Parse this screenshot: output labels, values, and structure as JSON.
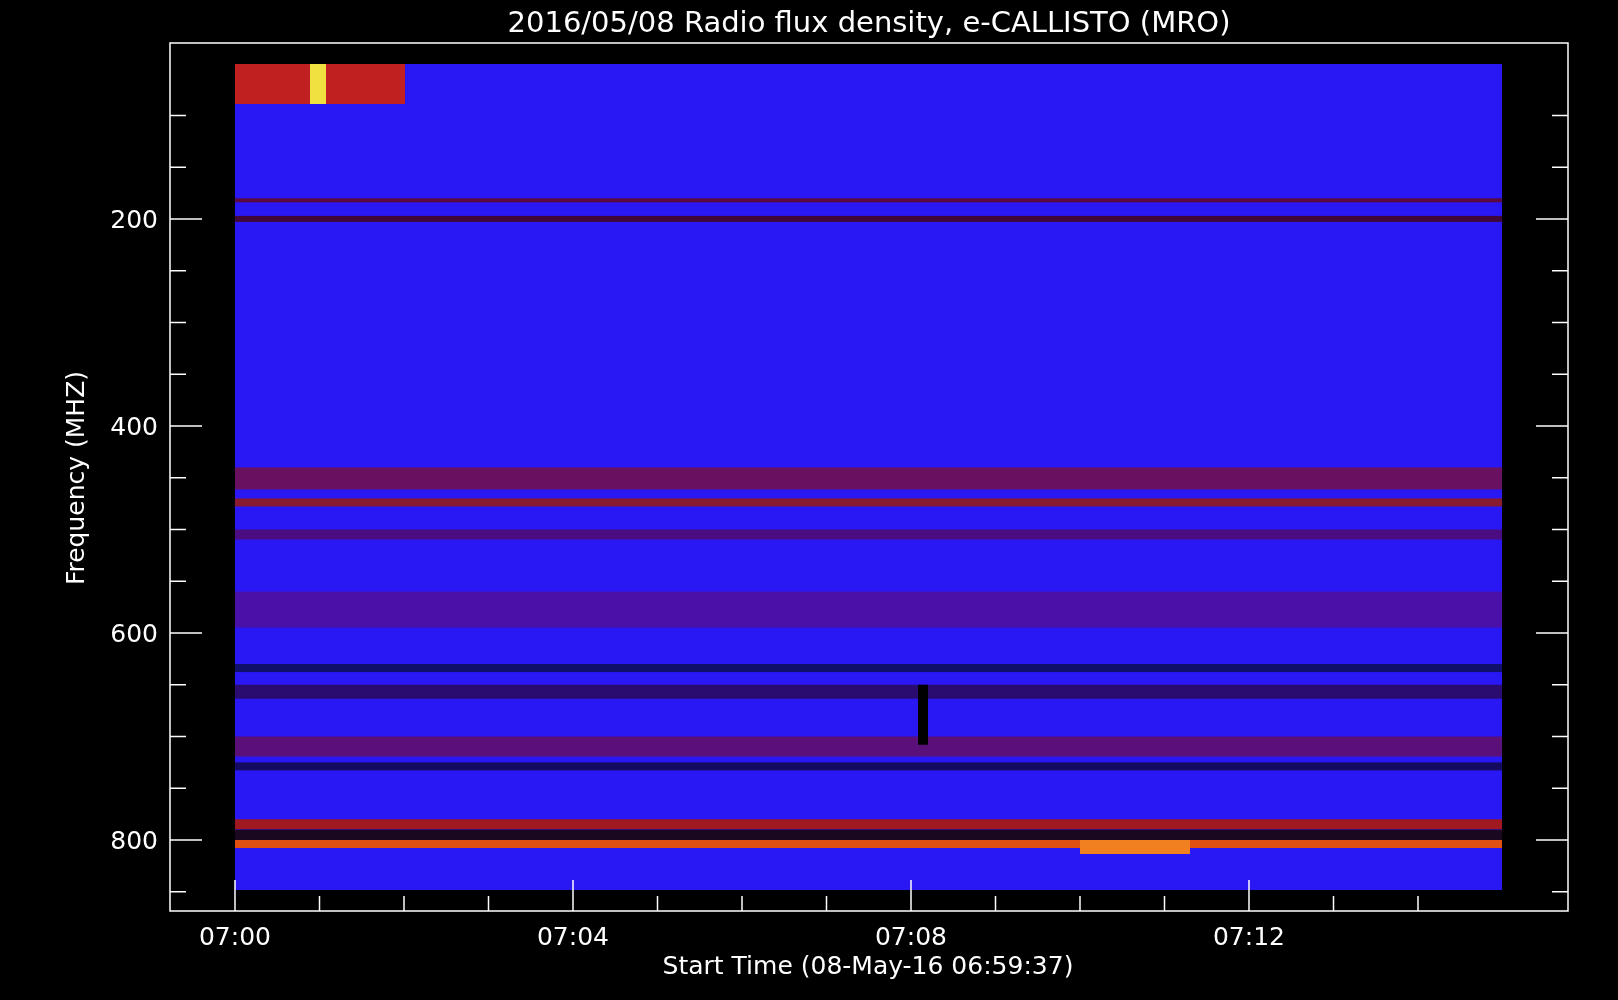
{
  "title": "2016/05/08  Radio flux density, e-CALLISTO (MRO)",
  "y_axis": {
    "label": "Frequency (MHZ)",
    "ticks": [
      "200",
      "400",
      "600",
      "800"
    ]
  },
  "x_axis": {
    "label": "Start Time (08-May-16 06:59:37)",
    "ticks": [
      "07:00",
      "07:04",
      "07:08",
      "07:12"
    ]
  }
}
